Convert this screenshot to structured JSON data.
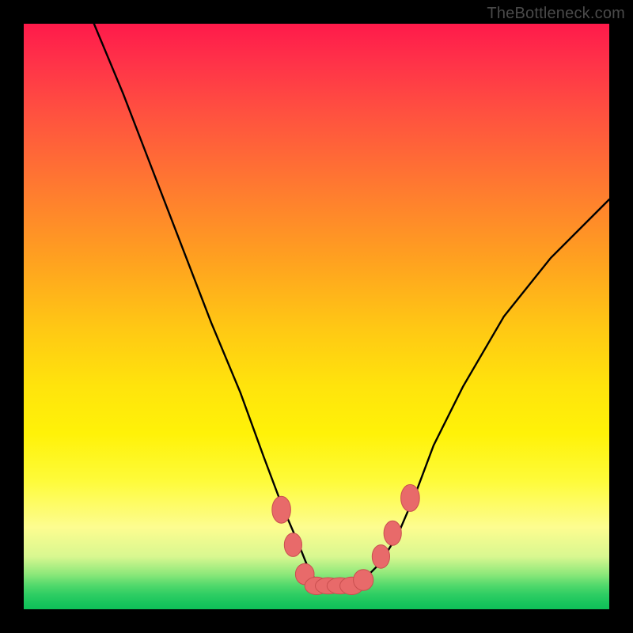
{
  "watermark": "TheBottleneck.com",
  "colors": {
    "frame": "#000000",
    "curve_stroke": "#000000",
    "marker_fill": "#e86a6a",
    "marker_stroke": "#c94f4f"
  },
  "chart_data": {
    "type": "line",
    "title": "",
    "xlabel": "",
    "ylabel": "",
    "xlim": [
      0,
      100
    ],
    "ylim": [
      0,
      100
    ],
    "grid": false,
    "legend": false,
    "note": "No axis ticks, labels, or legend are rendered in the image. Values are pixel-estimated on a 0–100 normalized scale.",
    "series": [
      {
        "name": "curve",
        "x": [
          12,
          17,
          22,
          27,
          32,
          37,
          41,
          44,
          47,
          49,
          51,
          53,
          55,
          58,
          61,
          64,
          67,
          70,
          75,
          82,
          90,
          100
        ],
        "y": [
          100,
          88,
          75,
          62,
          49,
          37,
          26,
          18,
          11,
          6,
          4,
          4,
          4,
          5,
          8,
          13,
          20,
          28,
          38,
          50,
          60,
          70
        ]
      }
    ],
    "markers": [
      {
        "x": 44,
        "y": 17,
        "rx": 1.6,
        "ry": 2.3
      },
      {
        "x": 46,
        "y": 11,
        "rx": 1.5,
        "ry": 2.0
      },
      {
        "x": 48,
        "y": 6,
        "rx": 1.6,
        "ry": 1.8
      },
      {
        "x": 50,
        "y": 4,
        "rx": 2.0,
        "ry": 1.5
      },
      {
        "x": 52,
        "y": 4,
        "rx": 2.2,
        "ry": 1.4
      },
      {
        "x": 54,
        "y": 4,
        "rx": 2.2,
        "ry": 1.4
      },
      {
        "x": 56,
        "y": 4,
        "rx": 2.0,
        "ry": 1.5
      },
      {
        "x": 58,
        "y": 5,
        "rx": 1.7,
        "ry": 1.8
      },
      {
        "x": 61,
        "y": 9,
        "rx": 1.5,
        "ry": 2.0
      },
      {
        "x": 63,
        "y": 13,
        "rx": 1.5,
        "ry": 2.1
      },
      {
        "x": 66,
        "y": 19,
        "rx": 1.6,
        "ry": 2.3
      }
    ]
  }
}
